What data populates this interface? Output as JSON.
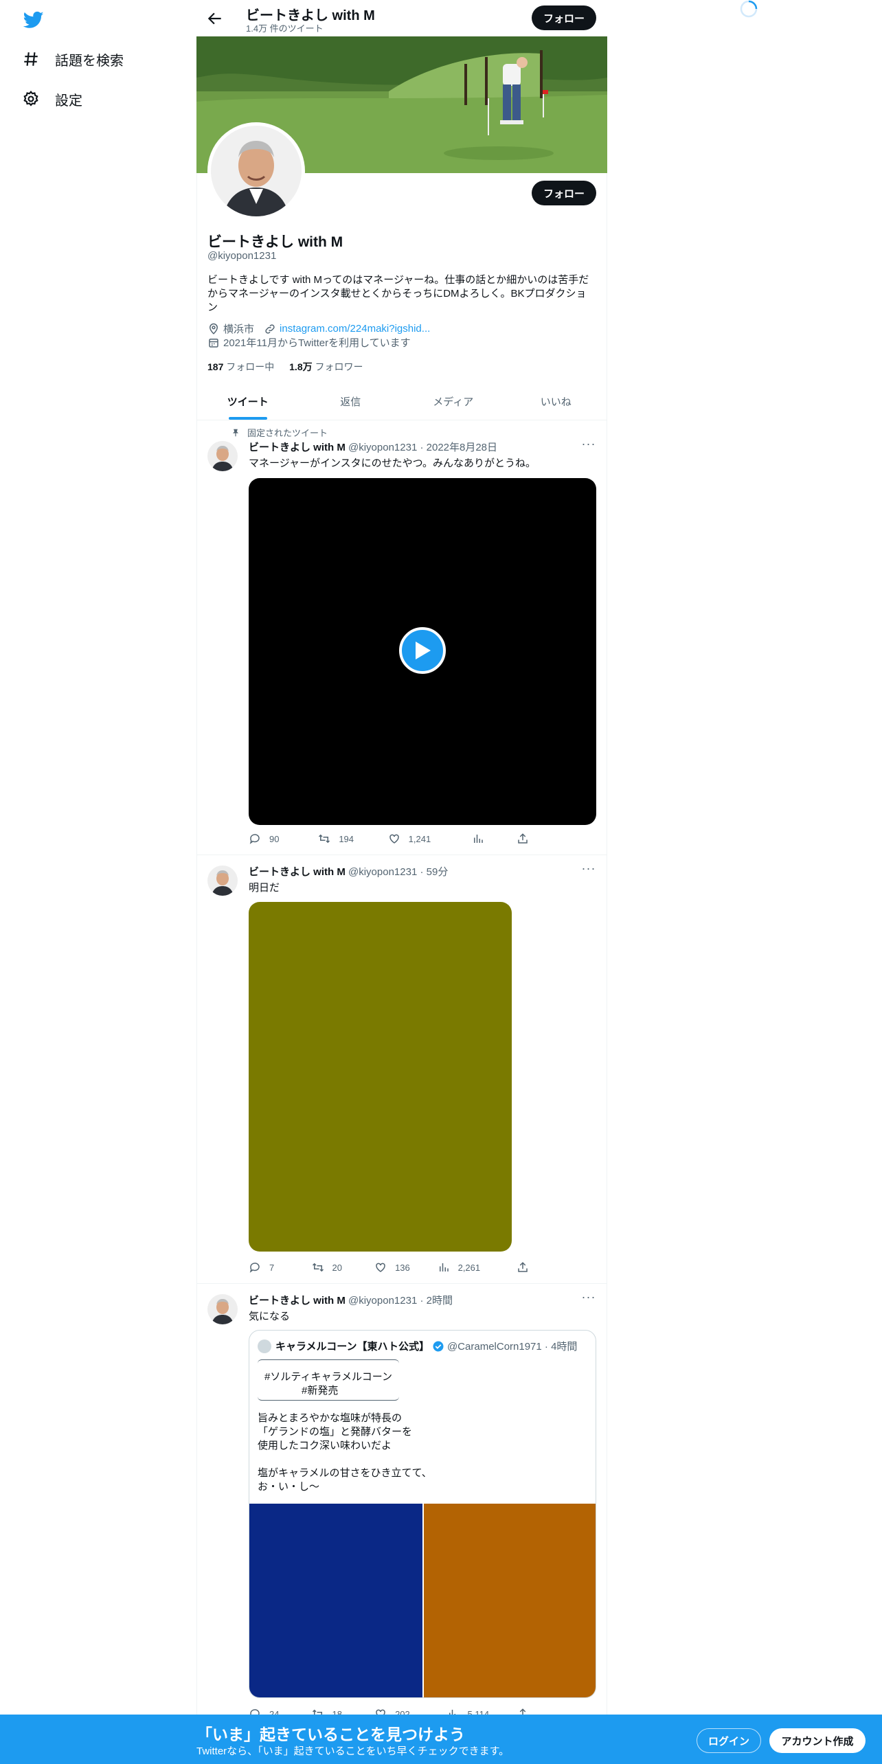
{
  "nav": {
    "explore_label": "話題を検索",
    "settings_label": "設定"
  },
  "header": {
    "title": "ビートきよし with M",
    "tweet_count": "1.4万 件のツイート",
    "follow_label": "フォロー"
  },
  "profile": {
    "follow_label": "フォロー",
    "name": "ビートきよし with M",
    "handle": "@kiyopon1231",
    "bio": "ビートきよしです with Mってのはマネージャーね。仕事の話とか細かいのは苦手だからマネージャーのインスタ載せとくからそっちにDMよろしく。BKプロダクション",
    "location": "横浜市",
    "website": "instagram.com/224maki?igshid...",
    "joined": "2021年11月からTwitterを利用しています",
    "following_count": "187",
    "following_label": "フォロー中",
    "followers_count": "1.8万",
    "followers_label": "フォロワー"
  },
  "tabs": [
    "ツイート",
    "返信",
    "メディア",
    "いいね"
  ],
  "tweets": [
    {
      "pinned_label": "固定されたツイート",
      "name": "ビートきよし with M",
      "meta": "@kiyopon1231 · 2022年8月28日",
      "text": "マネージャーがインスタにのせたやつ。みんなありがとうね。",
      "replies": "90",
      "retweets": "194",
      "likes": "1,241"
    },
    {
      "name": "ビートきよし with M",
      "meta": "@kiyopon1231 · 59分",
      "text": "明日だ",
      "replies": "7",
      "retweets": "20",
      "likes": "136",
      "views": "2,261"
    },
    {
      "name": "ビートきよし with M",
      "meta": "@kiyopon1231 · 2時間",
      "text": "気になる",
      "replies": "24",
      "retweets": "18",
      "likes": "202",
      "views": "5,114",
      "quote": {
        "name": "キャラメルコーン【東ハト公式】",
        "meta": "@CaramelCorn1971 · 4時間",
        "lines": [
          "#ソルティキャラメルコーン",
          "#新発売",
          "旨みとまろやかな塩味が特長の",
          "「ゲランドの塩」と発酵バターを",
          "使用したコク深い味わいだよ",
          "塩がキャラメルの甘さをひき立てて、",
          "お・い・し～"
        ]
      }
    }
  ],
  "bottom_bar": {
    "title": "「いま」起きていることを見つけよう",
    "subtitle": "Twitterなら、「いま」起きていることをいち早くチェックできます。",
    "login_label": "ログイン",
    "signup_label": "アカウント作成"
  },
  "colors": {
    "accent": "#1d9bf0",
    "video_bg": "#000000",
    "media_olive": "#7a7a00",
    "quote_blue": "#0a2886",
    "quote_orange": "#b36303"
  }
}
